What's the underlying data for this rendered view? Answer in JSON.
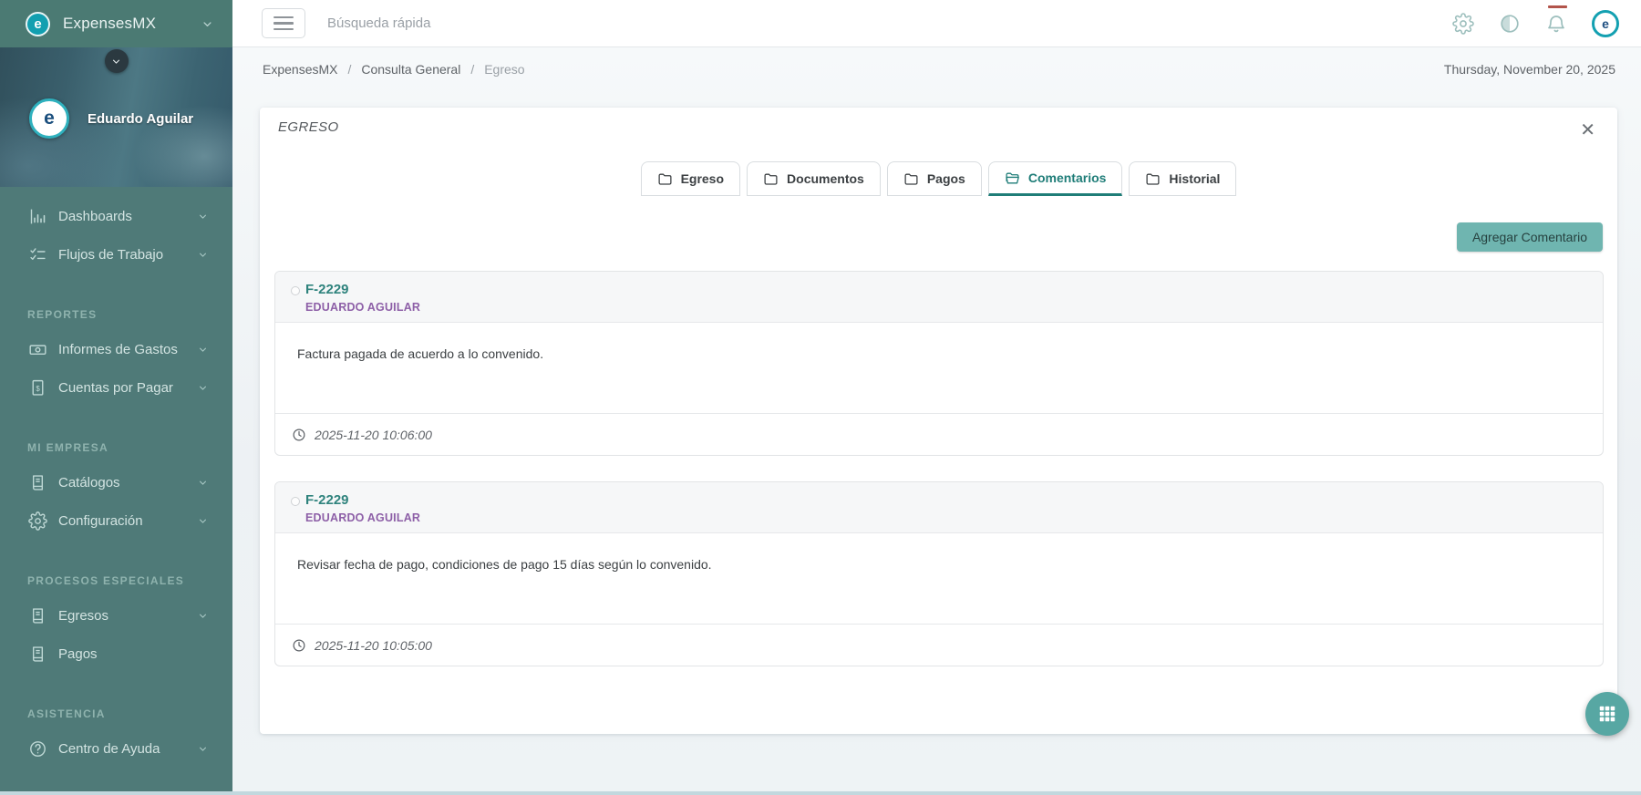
{
  "app": {
    "brand": "ExpensesMX"
  },
  "topbar": {
    "search_placeholder": "Búsqueda rápida",
    "avatar_initial": "e"
  },
  "sidebar": {
    "brand": "ExpensesMX",
    "logo_initial": "e",
    "user_name": "Eduardo Aguilar",
    "items": [
      {
        "type": "link",
        "icon": "bar-chart-icon",
        "label": "Dashboards",
        "chevron": true
      },
      {
        "type": "link",
        "icon": "checklist-icon",
        "label": "Flujos de Trabajo",
        "chevron": true
      },
      {
        "type": "section",
        "label": "REPORTES"
      },
      {
        "type": "link",
        "icon": "money-bill-icon",
        "label": "Informes de Gastos",
        "chevron": true
      },
      {
        "type": "link",
        "icon": "receipt-icon",
        "label": "Cuentas por Pagar",
        "chevron": true
      },
      {
        "type": "section",
        "label": "MI EMPRESA"
      },
      {
        "type": "link",
        "icon": "book-icon",
        "label": "Catálogos",
        "chevron": true
      },
      {
        "type": "link",
        "icon": "gear-icon",
        "label": "Configuración",
        "chevron": true
      },
      {
        "type": "section",
        "label": "PROCESOS ESPECIALES"
      },
      {
        "type": "link",
        "icon": "book-icon",
        "label": "Egresos",
        "chevron": true
      },
      {
        "type": "link",
        "icon": "book-icon",
        "label": "Pagos",
        "chevron": false
      },
      {
        "type": "section",
        "label": "ASISTENCIA"
      },
      {
        "type": "link",
        "icon": "help-circle-icon",
        "label": "Centro de Ayuda",
        "chevron": true
      }
    ]
  },
  "breadcrumb": {
    "items": [
      "ExpensesMX",
      "Consulta General",
      "Egreso"
    ],
    "separator": "/",
    "date": "Thursday, November 20, 2025"
  },
  "panel": {
    "title": "EGRESO",
    "close_glyph": "✕",
    "tabs": [
      {
        "label": "Egreso",
        "active": false
      },
      {
        "label": "Documentos",
        "active": false
      },
      {
        "label": "Pagos",
        "active": false
      },
      {
        "label": "Comentarios",
        "active": true
      },
      {
        "label": "Historial",
        "active": false
      }
    ],
    "add_comment_button": "Agregar Comentario",
    "comments": [
      {
        "ref": "F-2229",
        "author": "EDUARDO AGUILAR",
        "body": "Factura pagada de acuerdo a lo convenido.",
        "timestamp": "2025-11-20 10:06:00"
      },
      {
        "ref": "F-2229",
        "author": "EDUARDO AGUILAR",
        "body": "Revisar fecha de pago, condiciones de pago 15 días según lo convenido.",
        "timestamp": "2025-11-20 10:05:00"
      }
    ]
  },
  "colors": {
    "sidebar_teal": "#4f7a78",
    "accent_teal": "#1f7d78",
    "button_teal": "#6fb5b0",
    "fab_teal": "#57a7a3",
    "author_purple": "#8d5fa7",
    "notification_red": "#b2544b",
    "logo_teal": "#129fb0"
  }
}
